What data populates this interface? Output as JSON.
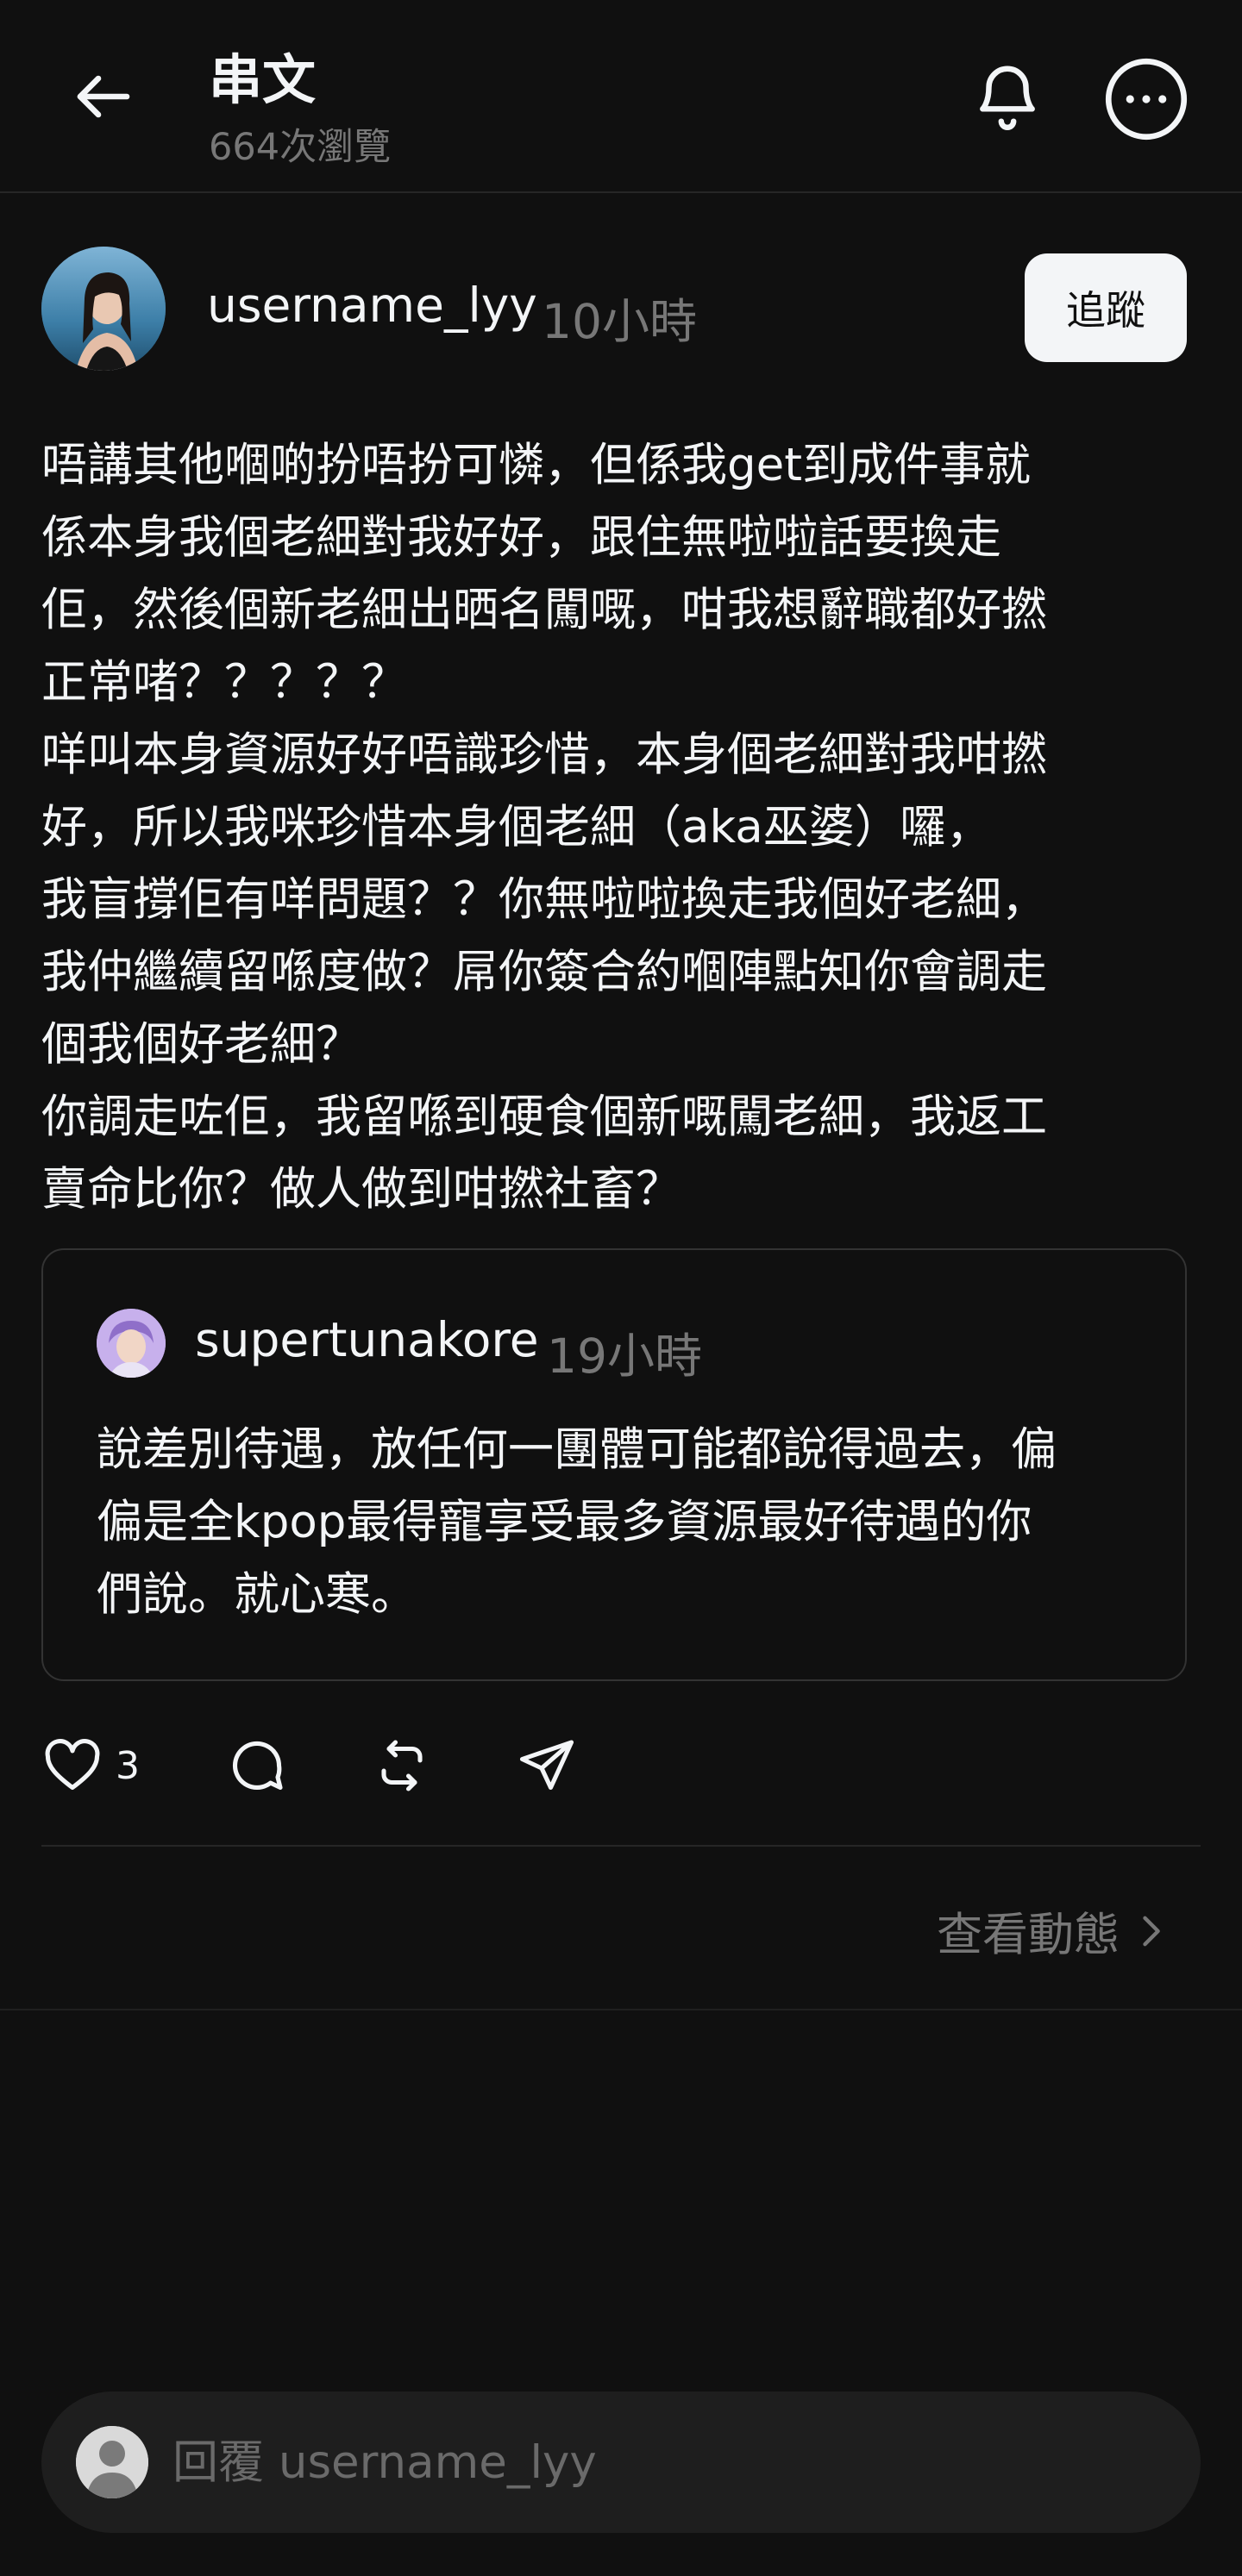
{
  "header": {
    "title": "串文",
    "views": "664次瀏覽",
    "icons": {
      "back": "back-arrow-icon",
      "notifications": "bell-icon",
      "more": "more-options-icon"
    }
  },
  "post": {
    "author": "username_lyy",
    "time": "10小時",
    "follow_label": "追蹤",
    "lines": [
      "唔講其他嗰啲扮唔扮可憐，但係我get到成件事就",
      "係本身我個老細對我好好，跟住無啦啦話要換走",
      "佢，然後個新老細出晒名闖嘅，咁我想辭職都好撚",
      "正常啫？？？？？",
      "咩叫本身資源好好唔識珍惜，本身個老細對我咁撚",
      "好，所以我咪珍惜本身個老細（aka巫婆）囉，",
      "我盲撐佢有咩問題？？你無啦啦換走我個好老細，",
      "我仲繼續留喺度做？屌你簽合約嗰陣點知你會調走",
      "個我個好老細？",
      "你調走咗佢，我留喺到硬食個新嘅闖老細，我返工",
      "賣命比你？做人做到咁撚社畜？"
    ]
  },
  "quote": {
    "author": "supertunakore",
    "time": "19小時",
    "lines": [
      "說差別待遇，放任何一團體可能都說得過去，偏",
      "偏是全kpop最得寵享受最多資源最好待遇的你",
      "們說。就心寒。"
    ]
  },
  "actions": {
    "like_count": "3",
    "icons": [
      "heart-icon",
      "comment-icon",
      "repost-icon",
      "share-icon"
    ]
  },
  "view_activity": "查看動態",
  "reply": {
    "placeholder": "回覆 username_lyy"
  },
  "colors": {
    "background": "#101010",
    "text": "#f3f5f7",
    "secondary": "#777777",
    "border": "#333333"
  }
}
